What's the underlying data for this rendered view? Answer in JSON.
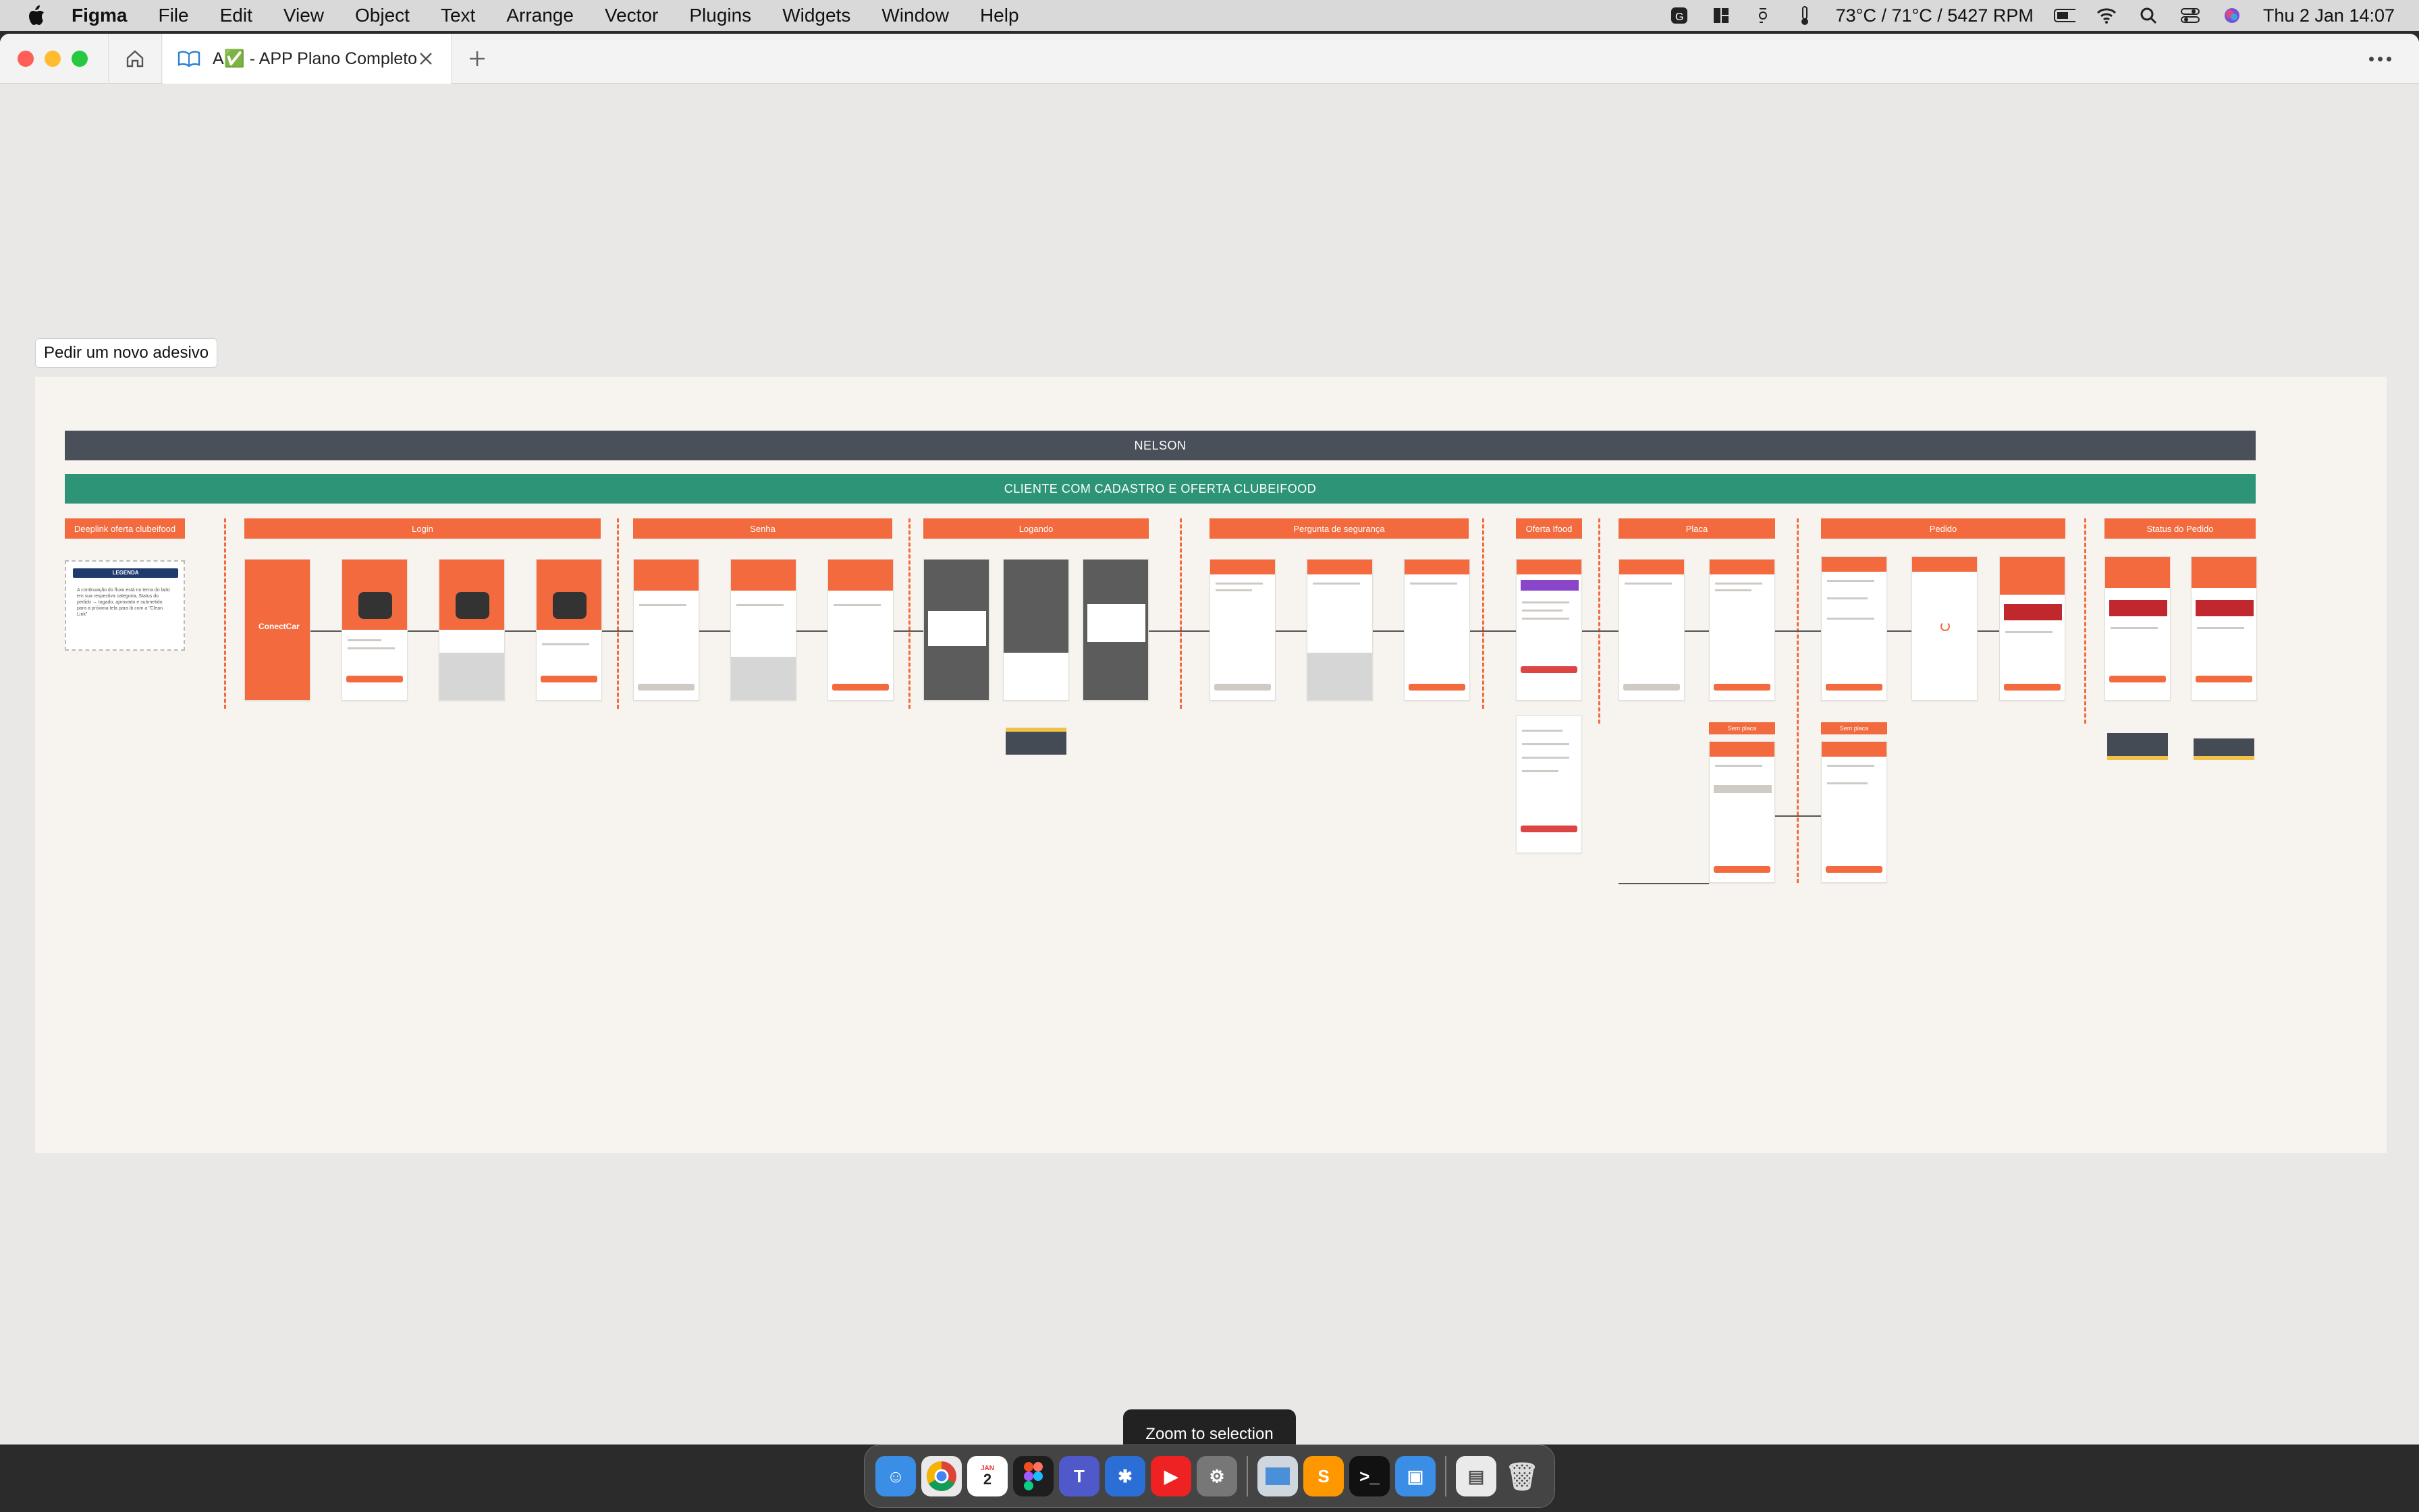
{
  "menubar": {
    "app_name": "Figma",
    "items": [
      "File",
      "Edit",
      "View",
      "Object",
      "Text",
      "Arrange",
      "Vector",
      "Plugins",
      "Widgets",
      "Window",
      "Help"
    ],
    "status_temp": "73°C / 71°C / 5427 RPM",
    "datetime": "Thu 2 Jan  14:07"
  },
  "window": {
    "tab_title": "A✅ - APP Plano Completo"
  },
  "canvas": {
    "section_label": "Pedir um novo adesivo",
    "bar_top": "NELSON",
    "bar_second": "CLIENTE COM CADASTRO E OFERTA CLUBEIFOOD",
    "column_headers": [
      "Deeplink oferta clubeifood",
      "Login",
      "Senha",
      "Logando",
      "Pergunta de segurança",
      "Oferta Ifood",
      "Placa",
      "Pedido",
      "Status do Pedido"
    ],
    "sub_headers": [
      "Sem placa",
      "Sem placa"
    ],
    "legend_title": "LEGENDA",
    "legend_text": "A continuação do fluxo está no tema do lado em sua respectiva categoria, Status do pedido → tagado, aprovado e submetido para a próxima tela para ib com a \"Clean Link\""
  },
  "colors": {
    "accent_orange": "#f26a3d",
    "bar_dark": "#4a505a",
    "bar_green": "#2e9478"
  },
  "toast": "Zoom to selection",
  "dock": {
    "calendar_day": "2",
    "calendar_month": "JAN"
  }
}
